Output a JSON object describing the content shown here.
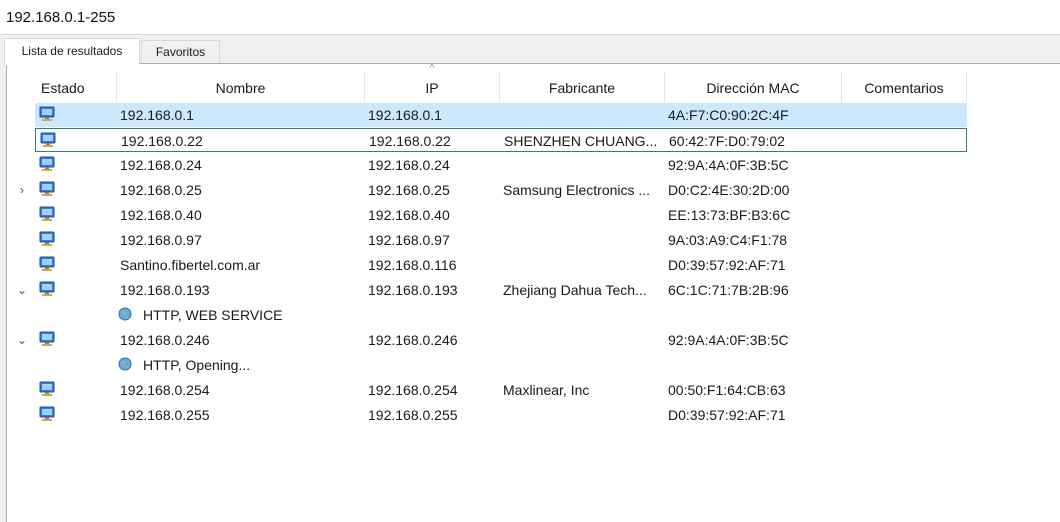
{
  "address": {
    "value": "192.168.0.1-255"
  },
  "tabs": [
    {
      "label": "Lista de resultados",
      "active": true
    },
    {
      "label": "Favoritos",
      "active": false
    }
  ],
  "columns": {
    "estado": "Estado",
    "nombre": "Nombre",
    "ip": "IP",
    "fabricante": "Fabricante",
    "mac": "Dirección MAC",
    "comentarios": "Comentarios"
  },
  "sort_indicator": "^",
  "colors": {
    "selection": "#cce8ff",
    "focus_border": "#2f7f7f"
  },
  "rows": [
    {
      "kind": "host",
      "icon": "computer-icon",
      "name": "192.168.0.1",
      "ip": "192.168.0.1",
      "vendor": "",
      "mac": "4A:F7:C0:90:2C:4F",
      "expander": "",
      "state": "selected"
    },
    {
      "kind": "host",
      "icon": "computer-icon",
      "name": "192.168.0.22",
      "ip": "192.168.0.22",
      "vendor": "SHENZHEN CHUANG...",
      "mac": "60:42:7F:D0:79:02",
      "expander": "",
      "state": "focused"
    },
    {
      "kind": "host",
      "icon": "computer-icon",
      "name": "192.168.0.24",
      "ip": "192.168.0.24",
      "vendor": "",
      "mac": "92:9A:4A:0F:3B:5C",
      "expander": "",
      "state": ""
    },
    {
      "kind": "host",
      "icon": "computer-icon",
      "name": "192.168.0.25",
      "ip": "192.168.0.25",
      "vendor": "Samsung Electronics ...",
      "mac": "D0:C2:4E:30:2D:00",
      "expander": "›",
      "state": ""
    },
    {
      "kind": "host",
      "icon": "computer-icon",
      "name": "192.168.0.40",
      "ip": "192.168.0.40",
      "vendor": "",
      "mac": "EE:13:73:BF:B3:6C",
      "expander": "",
      "state": ""
    },
    {
      "kind": "host",
      "icon": "computer-icon",
      "name": "192.168.0.97",
      "ip": "192.168.0.97",
      "vendor": "",
      "mac": "9A:03:A9:C4:F1:78",
      "expander": "",
      "state": ""
    },
    {
      "kind": "host",
      "icon": "computer-icon",
      "name": "Santino.fibertel.com.ar",
      "ip": "192.168.0.116",
      "vendor": "",
      "mac": "D0:39:57:92:AF:71",
      "expander": "",
      "state": ""
    },
    {
      "kind": "host",
      "icon": "computer-icon",
      "name": "192.168.0.193",
      "ip": "192.168.0.193",
      "vendor": "Zhejiang Dahua Tech...",
      "mac": "6C:1C:71:7B:2B:96",
      "expander": "⌄",
      "state": ""
    },
    {
      "kind": "service",
      "icon": "globe-icon",
      "name": "HTTP, WEB SERVICE"
    },
    {
      "kind": "host",
      "icon": "computer-icon",
      "name": "192.168.0.246",
      "ip": "192.168.0.246",
      "vendor": "",
      "mac": "92:9A:4A:0F:3B:5C",
      "expander": "⌄",
      "state": ""
    },
    {
      "kind": "service",
      "icon": "globe-icon",
      "name": "HTTP, Opening..."
    },
    {
      "kind": "host",
      "icon": "computer-icon",
      "name": "192.168.0.254",
      "ip": "192.168.0.254",
      "vendor": "Maxlinear, Inc",
      "mac": "00:50:F1:64:CB:63",
      "expander": "",
      "state": ""
    },
    {
      "kind": "host",
      "icon": "computer-icon",
      "name": "192.168.0.255",
      "ip": "192.168.0.255",
      "vendor": "",
      "mac": "D0:39:57:92:AF:71",
      "expander": "",
      "state": ""
    }
  ]
}
